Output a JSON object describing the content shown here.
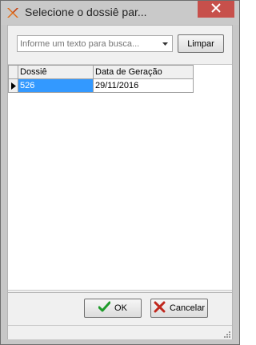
{
  "window": {
    "title": "Selecione o dossiê par...",
    "icon": "app-x-icon",
    "close_icon": "close-icon",
    "close_color": "#c7504b"
  },
  "search": {
    "placeholder": "Informe um texto para busca...",
    "value": "",
    "dropdown_icon": "chevron-down-icon",
    "clear_label": "Limpar"
  },
  "grid": {
    "columns": [
      "Dossiê",
      "Data de Geração"
    ],
    "rows": [
      {
        "dossie": "526",
        "data_geracao": "29/11/2016",
        "selected": true
      }
    ],
    "selection_color": "#3399ff"
  },
  "actions": {
    "ok_label": "OK",
    "ok_icon": "check-icon",
    "cancel_label": "Cancelar",
    "cancel_icon": "x-icon"
  }
}
